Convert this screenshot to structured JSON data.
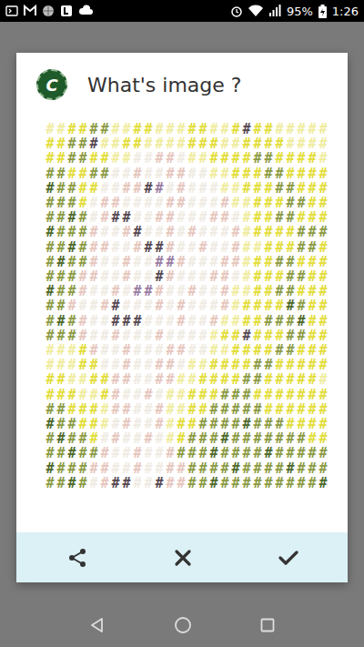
{
  "status_bar": {
    "battery": "95%",
    "time": "1:26"
  },
  "dialog": {
    "logo_letter": "C",
    "title": "What's image ?",
    "art": {
      "palette": {
        "Y": "#e3dd3c",
        "L": "#efec9e",
        "G": "#8d9b45",
        "D": "#4f6a2c",
        "P": "#e6c6bd",
        "W": "#efebe3",
        "K": "#574852",
        "M": "#9a7ea3"
      },
      "rows": [
        {
          "text": "##########################",
          "shades": "LLYYGGLLYYLLLYYLLYKYYLLLLL"
        },
        {
          "text": "##########################",
          "shades": "YYGGKLLYYLLLLYYYLLYYYYLLLL"
        },
        {
          "text": "##########################",
          "shades": "YYGGYYLLWWPPWLLYYYYGGYYYYL"
        },
        {
          "text": "##########################",
          "shades": "GGYYGGWWPWWPPWWLLYYYGGYYYY"
        },
        {
          "text": "##########################",
          "shades": "DGGYYWWPPKMWPWWWLLYYYGGYYY"
        },
        {
          "text": "##########################",
          "shades": "GGGYWPPWWWWPPWWWPLLYYYGGYY"
        },
        {
          "text": "##########################",
          "shades": "GGDGWPKKWWPPWWWPPWLYYGGYYY"
        },
        {
          "text": "##########################",
          "shades": "DGGGPWWPKWWPWPWWWPLYYYYGGG"
        },
        {
          "text": "##########################",
          "shades": "GGDGPPWWPKKPWWPWWPLLYYYGGY"
        },
        {
          "text": "##########################",
          "shades": "GDGGPWWPWWMMPWWWPPLYYGGYYY"
        },
        {
          "text": "##########################",
          "shades": "GGGPPWWPWWKPWWWPPWLYYYGGYY"
        },
        {
          "text": "##########################",
          "shades": "DGGPWWPWMMPWWPWWPLLYYGGYYY"
        },
        {
          "text": "##########################",
          "shades": "GGPWWPKWWWPWPWWWPLYYYYDGYY"
        },
        {
          "text": "##########################",
          "shades": "GDGPWWKKKWWWPWWPLLYYGGGDYY"
        },
        {
          "text": "##########################",
          "shades": "GGGPWWPWWWPWWWWLYYKYYYGGYY"
        },
        {
          "text": "##########################",
          "shades": "LLLYPWWPWWWPPWWLLYYYYGGYYY"
        },
        {
          "text": "##########################",
          "shades": "LLLYYWWPWWPPWLLYYYYGGYYYYY"
        },
        {
          "text": "##########################",
          "shades": "YYLLYYPPWWPPLLYYYYGGYYYYYL"
        },
        {
          "text": "##########################",
          "shades": "YYYLLYPWWPWLLYYYGGGYYYYYYY"
        },
        {
          "text": "##########################",
          "shades": "GGYYYLPPWWPLLYYGGGGGYYYYYY"
        },
        {
          "text": "##########################",
          "shades": "DGGYYLWPWWPLYYGGGGDGGGYYYY"
        },
        {
          "text": "##########################",
          "shades": "GDGGYWPWWPWLYGGGDGGGGGGGYY"
        },
        {
          "text": "##########################",
          "shades": "GGDGGPWWPWWPGGGDGGGGDGGGGG"
        },
        {
          "text": "##########################",
          "shades": "DGGGPPWWPWWPPGGGGDGGGGDGGG"
        },
        {
          "text": "##########################",
          "shades": "GGDGWPKKWWKPPGGDGGGGGGGGGD"
        }
      ]
    }
  }
}
